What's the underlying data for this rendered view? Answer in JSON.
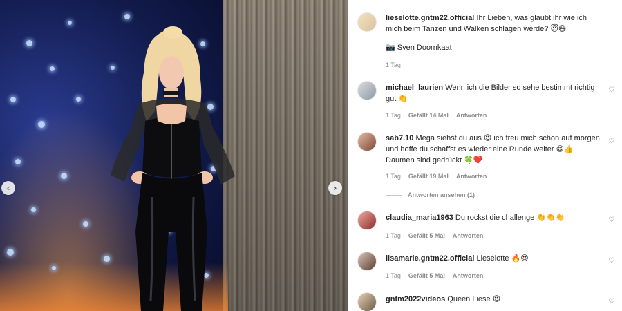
{
  "post": {
    "caption": {
      "username": "lieselotte.gntm22.official",
      "text": "Ihr Lieben, was glaubt ihr wie ich mich beim Tanzen und Walken schlagen werde? 😇😄",
      "credit": "📷 Sven Doornkaat",
      "time": "1 Tag"
    }
  },
  "media": {
    "prev_icon": "chevron-left-icon",
    "next_icon": "chevron-right-icon",
    "prev_glyph": "‹",
    "next_glyph": "›"
  },
  "labels": {
    "reply": "Antworten",
    "view_replies": "Antworten ansehen (1)"
  },
  "comments": [
    {
      "username": "michael_laurien",
      "text": "Wenn ich die Bilder so sehe bestimmt richtig gut 👏",
      "time": "1 Tag",
      "likes": "Gefällt 14 Mal"
    },
    {
      "username": "sab7.10",
      "text": "Mega siehst du aus 😍 ich freu mich schon auf morgen und hoffe du schaffst es wieder eine Runde weiter 😀👍 Daumen sind gedrückt 🍀❤️",
      "time": "1 Tag",
      "likes": "Gefällt 19 Mal"
    },
    {
      "username": "claudia_maria1963",
      "text": "Du rockst die challenge 👏👏👏",
      "time": "1 Tag",
      "likes": "Gefällt 5 Mal"
    },
    {
      "username": "lisamarie.gntm22.official",
      "text": "Lieselotte 🔥😍",
      "time": "1 Tag",
      "likes": "Gefällt 5 Mal"
    },
    {
      "username": "gntm2022videos",
      "text": "Queen Liese 😍",
      "time": "",
      "likes": ""
    }
  ],
  "colors": {
    "text": "#262626",
    "muted": "#8e8e8e",
    "divider": "#efefef"
  }
}
